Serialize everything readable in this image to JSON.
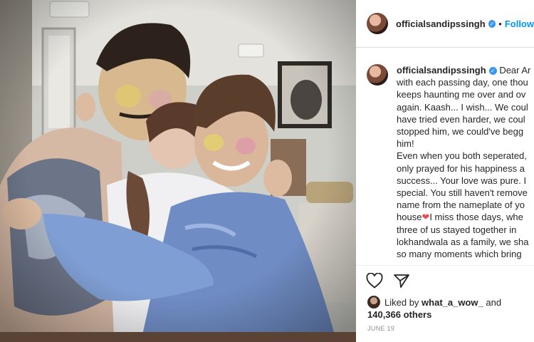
{
  "post": {
    "username": "officialsandipssingh",
    "separator": "•",
    "follow_label": "Follow",
    "caption_lines": [
      "Dear Ar",
      "with each passing day, one thou",
      "keeps haunting me over and ov",
      "again. Kaash... I wish... We coul",
      "have tried even harder, we coul",
      "stopped him, we could've begg",
      "him!",
      "Even when you both seperated,",
      "only prayed for his happiness a",
      "success... Your love was pure. I",
      "special. You still haven't remove",
      "name from the nameplate of yo",
      "house",
      "I miss those days, whe",
      "three of us stayed together in",
      "lokhandwala as a family, we sha",
      "so many moments which bring"
    ],
    "heart_glyph": "❤",
    "liked_by_prefix": "Liked by",
    "liked_by_user": "what_a_wow_",
    "liked_by_and": "and",
    "likes_count": "140,366 others",
    "date": "JUNE 19"
  },
  "icons": {
    "verified": "verified-badge-icon",
    "like": "heart-outline-icon",
    "share": "paper-plane-icon"
  },
  "colors": {
    "link_blue": "#0095f6",
    "text": "#262626",
    "muted": "#8e8e8e",
    "verified_blue": "#3897f0"
  }
}
